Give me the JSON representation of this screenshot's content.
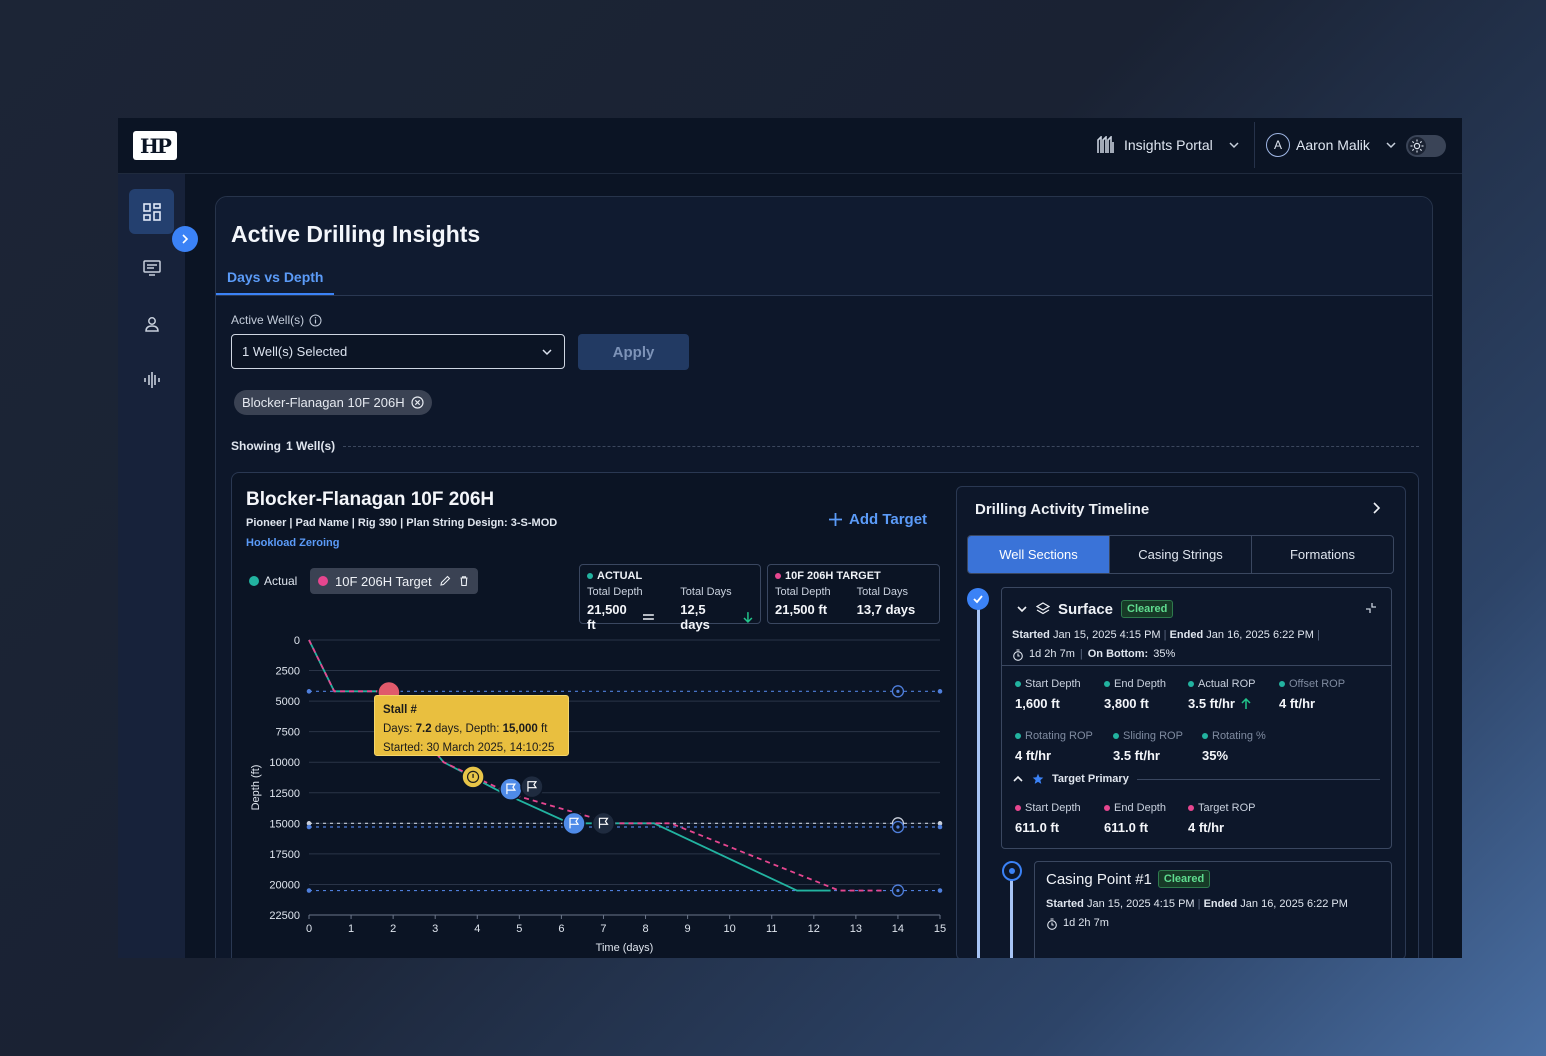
{
  "topbar": {
    "logo": "HP",
    "portal_label": "Insights Portal",
    "user_initial": "A",
    "user_name": "Aaron Malik"
  },
  "page": {
    "title": "Active Drilling Insights",
    "tab": "Days vs Depth",
    "active_wells_label": "Active Well(s)",
    "select_value": "1 Well(s) Selected",
    "apply_label": "Apply",
    "chip_label": "Blocker-Flanagan 10F 206H",
    "showing_label": "Showing",
    "showing_count": "1 Well(s)"
  },
  "well": {
    "title": "Blocker-Flanagan 10F 206H",
    "meta": "Pioneer | Pad Name | Rig 390 | Plan String Design: 3-S-MOD",
    "link": "Hookload Zeroing",
    "add_target": "Add Target",
    "legend_actual": "Actual",
    "legend_target": "10F 206H Target",
    "actual_box": {
      "title": "ACTUAL",
      "depth_label": "Total Depth",
      "depth_value": "21,500 ft",
      "days_label": "Total Days",
      "days_value": "12,5 days"
    },
    "target_box": {
      "title": "10F 206H TARGET",
      "depth_label": "Total Depth",
      "depth_value": "21,500 ft",
      "days_label": "Total Days",
      "days_value": "13,7 days"
    },
    "tooltip": {
      "title": "Stall #",
      "days_label": "Days:",
      "days_value": "7.2",
      "days_unit": "days,",
      "depth_label": "Depth:",
      "depth_value": "15,000",
      "depth_unit": "ft",
      "started": "Started: 30 March 2025, 14:10:25"
    }
  },
  "chart_data": {
    "type": "line",
    "xlabel": "Time (days)",
    "ylabel": "Depth (ft)",
    "xlim": [
      0,
      15
    ],
    "ylim": [
      0,
      22500
    ],
    "y_inverted": true,
    "x_ticks": [
      0,
      1,
      2,
      3,
      4,
      5,
      6,
      7,
      8,
      9,
      10,
      11,
      12,
      13,
      14,
      15
    ],
    "y_ticks": [
      0,
      2500,
      5000,
      7500,
      10000,
      12500,
      15000,
      17500,
      20000,
      22500
    ],
    "series": [
      {
        "name": "Actual",
        "color": "#22b3a0",
        "style": "solid",
        "x": [
          0,
          0.6,
          1.8,
          3.2,
          4.6,
          6.2,
          8.2,
          11.6,
          12.4
        ],
        "y": [
          0,
          4200,
          4200,
          10000,
          12500,
          15000,
          15000,
          20500,
          20500
        ]
      },
      {
        "name": "10F 206H Target",
        "color": "#e6468f",
        "style": "dashed",
        "x": [
          0,
          0.6,
          1.8,
          3.2,
          4.8,
          7.2,
          8.6,
          12.6,
          13.7
        ],
        "y": [
          0,
          4200,
          4200,
          10000,
          12600,
          15000,
          15000,
          20500,
          20500
        ]
      }
    ],
    "reference_lines": [
      {
        "y": 4200,
        "color": "#4f7fdc"
      },
      {
        "y": 15000,
        "color": "#c9cfda"
      },
      {
        "y": 15300,
        "color": "#4f7fdc"
      },
      {
        "y": 20500,
        "color": "#4f7fdc"
      }
    ],
    "markers": [
      {
        "x": 1.9,
        "y": 4300,
        "kind": "stall",
        "color": "#e05a6b"
      },
      {
        "x": 3.9,
        "y": 11200,
        "kind": "warning",
        "color": "#e8c548"
      },
      {
        "x": 4.8,
        "y": 12200,
        "kind": "flag",
        "color": "#4f8be8"
      },
      {
        "x": 5.3,
        "y": 12000,
        "kind": "flag",
        "color": "#1f2b3f"
      },
      {
        "x": 6.3,
        "y": 15000,
        "kind": "flag",
        "color": "#4f8be8"
      },
      {
        "x": 7.0,
        "y": 15000,
        "kind": "flag",
        "color": "#1f2b3f"
      }
    ]
  },
  "timeline": {
    "title": "Drilling Activity Timeline",
    "tabs": [
      "Well Sections",
      "Casing Strings",
      "Formations"
    ],
    "section": {
      "name": "Surface",
      "badge": "Cleared",
      "started_label": "Started",
      "started_value": "Jan 15, 2025 4:15 PM",
      "ended_label": "Ended",
      "ended_value": "Jan 16, 2025 6:22 PM",
      "duration": "1d 2h 7m",
      "on_bottom_label": "On Bottom:",
      "on_bottom_value": "35%",
      "metrics": [
        {
          "label": "Start Depth",
          "value": "1,600 ft",
          "color": "#22b3a0",
          "dim": false
        },
        {
          "label": "End Depth",
          "value": "3,800 ft",
          "color": "#22b3a0",
          "dim": false
        },
        {
          "label": "Actual ROP",
          "value": "3.5 ft/hr",
          "color": "#22b3a0",
          "dim": false,
          "trend": "up"
        },
        {
          "label": "Offset ROP",
          "value": "4 ft/hr",
          "color": "#22b3a0",
          "dim": true
        },
        {
          "label": "Rotating ROP",
          "value": "4 ft/hr",
          "color": "#22b3a0",
          "dim": true
        },
        {
          "label": "Sliding ROP",
          "value": "3.5 ft/hr",
          "color": "#22b3a0",
          "dim": true
        },
        {
          "label": "Rotating %",
          "value": "35%",
          "color": "#22b3a0",
          "dim": true
        }
      ],
      "target_label": "Target Primary",
      "target_metrics": [
        {
          "label": "Start Depth",
          "value": "611.0 ft",
          "color": "#e6468f"
        },
        {
          "label": "End Depth",
          "value": "611.0 ft",
          "color": "#e6468f"
        },
        {
          "label": "Target ROP",
          "value": "4 ft/hr",
          "color": "#e6468f"
        }
      ]
    },
    "casing": {
      "name": "Casing Point #1",
      "badge": "Cleared",
      "started_label": "Started",
      "started_value": "Jan 15, 2025 4:15 PM",
      "ended_label": "Ended",
      "ended_value": "Jan 16, 2025 6:22 PM",
      "duration": "1d 2h 7m"
    }
  }
}
